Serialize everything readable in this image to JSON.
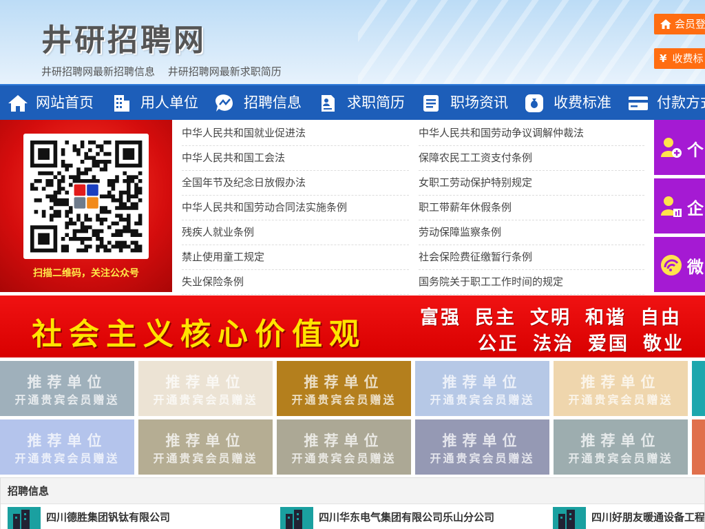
{
  "header": {
    "site_title": "井研招聘网",
    "links": [
      "井研招聘网最新招聘信息",
      "井研招聘网最新求职简历"
    ],
    "member_login": "会员登",
    "fee_standard": "收费标"
  },
  "nav": {
    "items": [
      {
        "label": "网站首页",
        "icon": "home-icon"
      },
      {
        "label": "用人单位",
        "icon": "building-icon"
      },
      {
        "label": "招聘信息",
        "icon": "chart-icon"
      },
      {
        "label": "求职简历",
        "icon": "resume-icon"
      },
      {
        "label": "职场资讯",
        "icon": "news-icon"
      },
      {
        "label": "收费标准",
        "icon": "money-bag-icon"
      },
      {
        "label": "付款方式",
        "icon": "card-icon"
      }
    ]
  },
  "qr": {
    "caption": "扫描二维码，关注公众号"
  },
  "laws": {
    "left": [
      "中华人民共和国就业促进法",
      "中华人民共和国工会法",
      "全国年节及纪念日放假办法",
      "中华人民共和国劳动合同法实施条例",
      "残疾人就业条例",
      "禁止使用童工规定",
      "失业保险条例"
    ],
    "right": [
      "中华人民共和国劳动争议调解仲裁法",
      "保障农民工工资支付条例",
      "女职工劳动保护特别规定",
      "职工带薪年休假条例",
      "劳动保障监察条例",
      "社会保险费征缴暂行条例",
      "国务院关于职工工作时间的规定"
    ]
  },
  "side_buttons": [
    {
      "label": "个",
      "icon": "person-add-icon"
    },
    {
      "label": "企",
      "icon": "enterprise-icon"
    },
    {
      "label": "微",
      "icon": "wechat-icon"
    }
  ],
  "values_banner": {
    "title": "社会主义核心价值观",
    "row1": [
      "富强",
      "民主",
      "文明",
      "和谐",
      "自由"
    ],
    "row2": [
      "公正",
      "法治",
      "爱国",
      "敬业"
    ]
  },
  "ads": {
    "line1": "推荐单位",
    "line2": "开通贵宾会员赠送",
    "colors": [
      "#9fb0bb",
      "#ece3d4",
      "#b47f1d",
      "#b6c8e6",
      "#efd6ad",
      "#1ea7ad",
      "#b4c4ec",
      "#b5ad93",
      "#aca895",
      "#9599b4",
      "#9dadaf",
      "#e0704c"
    ]
  },
  "jobs": {
    "heading": "招聘信息",
    "items": [
      "四川德胜集团钒钛有限公司",
      "四川华东电气集团有限公司乐山分公司",
      "四川好朋友暖通设备工程"
    ]
  }
}
